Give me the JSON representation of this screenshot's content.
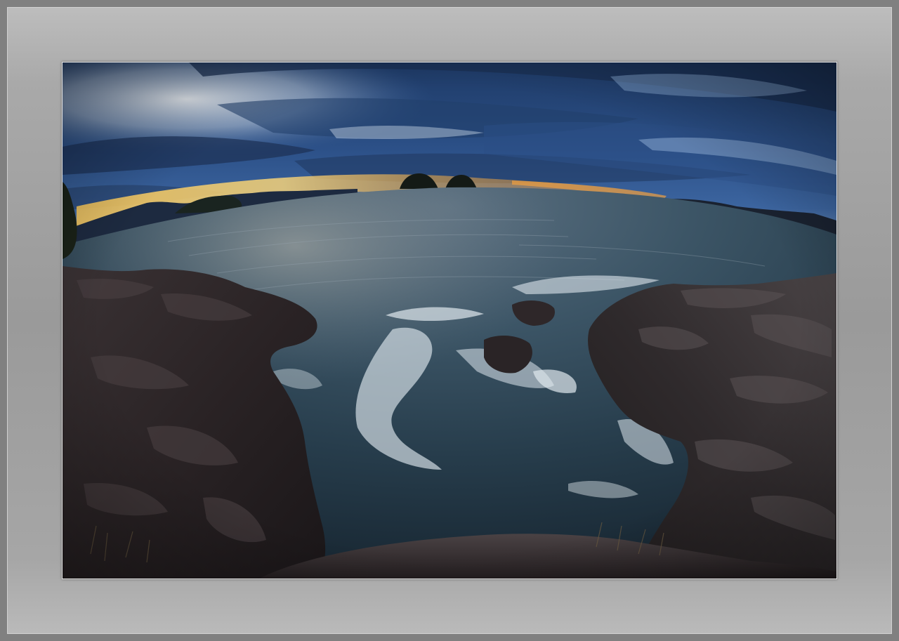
{
  "image": {
    "kind": "fisheye seascape photograph in a gray mat frame",
    "colors": {
      "frame": "#808080",
      "mat": "#a6a6a6",
      "sky_deep": "#1c3a66",
      "sky_light": "#dfe6ee",
      "sunset_glow": "#f2c25a",
      "sea": "#2e4656",
      "foam": "#dfe8ee",
      "rock": "#2a2426"
    }
  }
}
